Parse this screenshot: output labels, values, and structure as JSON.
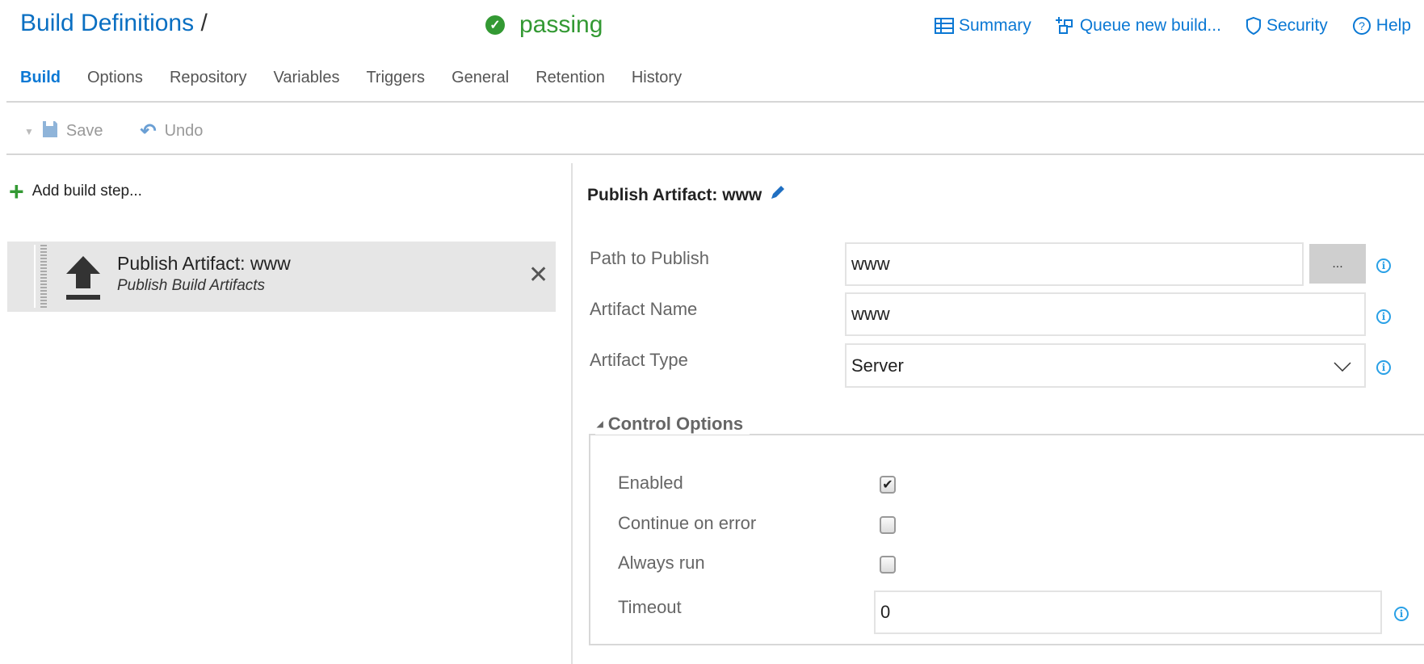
{
  "header": {
    "title": "Build Definitions",
    "separator": "/",
    "status": "passing",
    "status_color": "#339933",
    "links": [
      {
        "label": "Summary",
        "icon": "table-icon"
      },
      {
        "label": "Queue new build...",
        "icon": "queue-icon"
      },
      {
        "label": "Security",
        "icon": "shield-icon"
      },
      {
        "label": "Help",
        "icon": "help-circle-icon"
      }
    ]
  },
  "tabs": [
    "Build",
    "Options",
    "Repository",
    "Variables",
    "Triggers",
    "General",
    "Retention",
    "History"
  ],
  "active_tab": "Build",
  "toolbar": {
    "save": "Save",
    "undo": "Undo"
  },
  "left": {
    "add_step": "Add build step...",
    "step": {
      "name": "Publish Artifact: www",
      "desc": "Publish Build Artifacts"
    }
  },
  "detail": {
    "title": "Publish Artifact: www",
    "fields": {
      "path_label": "Path to Publish",
      "path_value": "www",
      "browse": "...",
      "name_label": "Artifact Name",
      "name_value": "www",
      "type_label": "Artifact Type",
      "type_value": "Server"
    },
    "control": {
      "legend": "Control Options",
      "enabled": "Enabled",
      "enabled_checked": true,
      "continue": "Continue on error",
      "continue_checked": false,
      "always": "Always run",
      "always_checked": false,
      "timeout_label": "Timeout",
      "timeout_value": "0"
    }
  },
  "colors": {
    "accent": "#0a78d4",
    "success": "#339933",
    "info": "#29a0e6"
  }
}
